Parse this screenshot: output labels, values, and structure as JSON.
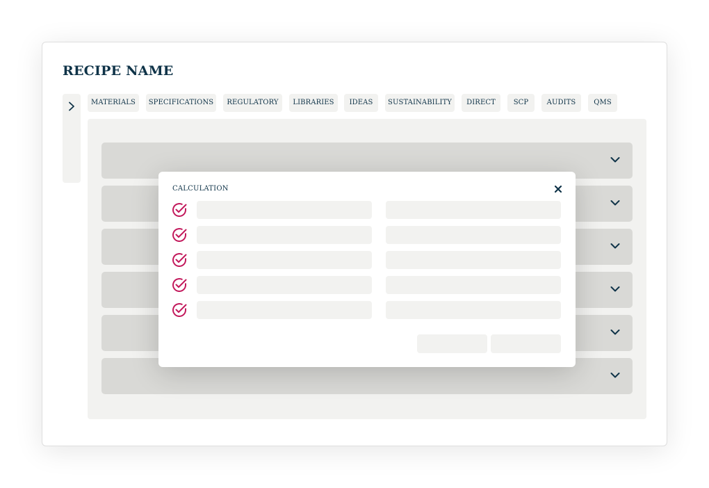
{
  "page": {
    "title": "RECIPE NAME"
  },
  "tabs": [
    {
      "label": "MATERIALS"
    },
    {
      "label": "SPECIFICATIONS"
    },
    {
      "label": "REGULATORY"
    },
    {
      "label": "LIBRARIES"
    },
    {
      "label": "IDEAS"
    },
    {
      "label": "SUSTAINABILITY"
    },
    {
      "label": "DIRECT"
    },
    {
      "label": "SCP"
    },
    {
      "label": "AUDITS"
    },
    {
      "label": "QMS"
    }
  ],
  "accordion": {
    "row_count": 6,
    "icon": "chevron-down-icon"
  },
  "modal": {
    "title": "CALCULATION",
    "close_icon": "close-icon",
    "rows": [
      {
        "status_icon": "check-circle-icon",
        "left_value": "",
        "right_value": ""
      },
      {
        "status_icon": "check-circle-icon",
        "left_value": "",
        "right_value": ""
      },
      {
        "status_icon": "check-circle-icon",
        "left_value": "",
        "right_value": ""
      },
      {
        "status_icon": "check-circle-icon",
        "left_value": "",
        "right_value": ""
      },
      {
        "status_icon": "check-circle-icon",
        "left_value": "",
        "right_value": ""
      }
    ],
    "buttons": [
      {
        "label": ""
      },
      {
        "label": ""
      }
    ]
  },
  "colors": {
    "text_primary": "#0f3348",
    "check_accent": "#c2185b",
    "surface_light": "#f2f2f0",
    "surface_row": "#d9d9d6"
  }
}
